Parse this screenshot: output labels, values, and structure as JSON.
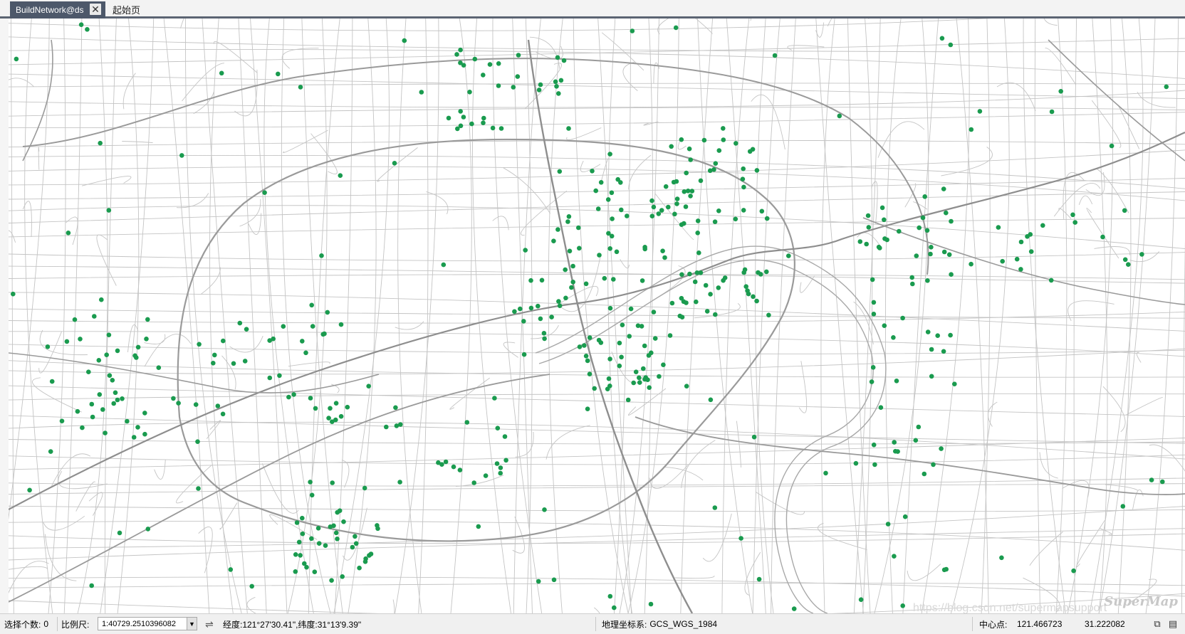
{
  "tabs": {
    "active_label": "BuildNetwork@ds",
    "close_symbol": "✕",
    "start_page_label": "起始页"
  },
  "status": {
    "selected_label": "选择个数:",
    "selected_count": "0",
    "scale_label": "比例尺:",
    "scale_value": "1:40729.2510396082",
    "swap_icon": "⇌",
    "lonlat_text": "经度:121°27'30.41\",纬度:31°13'9.39\"",
    "crs_label": "地理坐标系:",
    "crs_value": "GCS_WGS_1984",
    "center_label": "中心点:",
    "center_x": "121.466723",
    "center_y": "31.222082"
  },
  "map": {
    "watermark": "SuperMap",
    "url_watermark": "https://blog.csdn.net/supermapsupport",
    "road_color": "#b4b4b4",
    "major_road_color": "#9a9a9a",
    "point_color": "#1a9b4f"
  },
  "icons": {
    "dropdown": "chevron-down-icon",
    "swap": "swap-arrows-icon",
    "copy": "copy-icon",
    "paste": "paste-icon"
  }
}
